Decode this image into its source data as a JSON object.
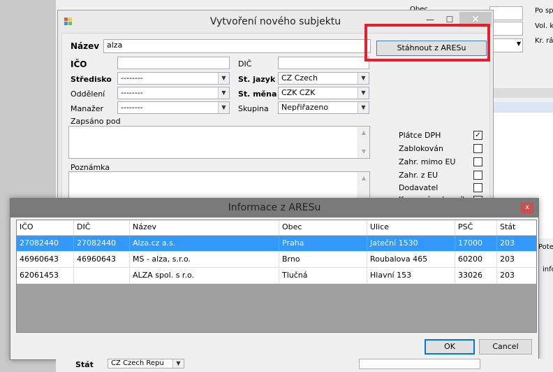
{
  "background": {
    "right_labels": [
      "Obec",
      "Po sp",
      "Vol. k",
      "Kr. rá"
    ],
    "right_texts": [
      "Pote",
      "info"
    ],
    "bottom_label": "Stát",
    "bottom_select": "CZ  Czech Repu"
  },
  "dialog": {
    "title": "Vytvoření nového subjektu",
    "ares_button": "Stáhnout z ARESu",
    "fields": {
      "nazev_label": "Název",
      "nazev_value": "alza",
      "ico_label": "IČO",
      "ico_value": "",
      "dic_label": "DIČ",
      "dic_value": "",
      "stredisko_label": "Středisko",
      "stredisko_value": "--------",
      "jazyk_label": "St. jazyk",
      "jazyk_value": "CZ  Czech",
      "oddeleni_label": "Oddělení",
      "oddeleni_value": "--------",
      "mena_label": "St. měna",
      "mena_value": "CZK  CZK",
      "manazer_label": "Manažer",
      "manazer_value": "--------",
      "skupina_label": "Skupina",
      "skupina_value": "Nepřiřazeno",
      "zapsano_label": "Zapsáno pod",
      "poznamka_label": "Poznámka"
    },
    "checkboxes": [
      {
        "label": "Plátce DPH",
        "checked": true
      },
      {
        "label": "Zablokován",
        "checked": false
      },
      {
        "label": "Zahr. mimo EU",
        "checked": false
      },
      {
        "label": "Zahr. z EU",
        "checked": false
      },
      {
        "label": "Dodavatel",
        "checked": false
      },
      {
        "label": "Koncový zakazník",
        "checked": false
      }
    ],
    "check_mark": "✓"
  },
  "ares": {
    "title": "Informace z ARESu",
    "close_glyph": "x",
    "columns": [
      "IČO",
      "DIČ",
      "Název",
      "Obec",
      "Ulice",
      "PSČ",
      "Stát"
    ],
    "rows": [
      [
        "27082440",
        "27082440",
        "Alza.cz a.s.",
        "Praha",
        "Jateční 1530",
        "17000",
        "203"
      ],
      [
        "46960643",
        "46960643",
        "MS - alza, s.r.o.",
        "Brno",
        "Roubalova 465",
        "60200",
        "203"
      ],
      [
        "62061453",
        "",
        "ALZA spol. s r.o.",
        "Tlučná",
        "Hlavní 153",
        "33026",
        "203"
      ]
    ],
    "selected_row": 0,
    "ok_label": "OK",
    "cancel_label": "Cancel"
  },
  "colors": {
    "selection": "#3399ff",
    "highlight_border": "#e3202b"
  }
}
